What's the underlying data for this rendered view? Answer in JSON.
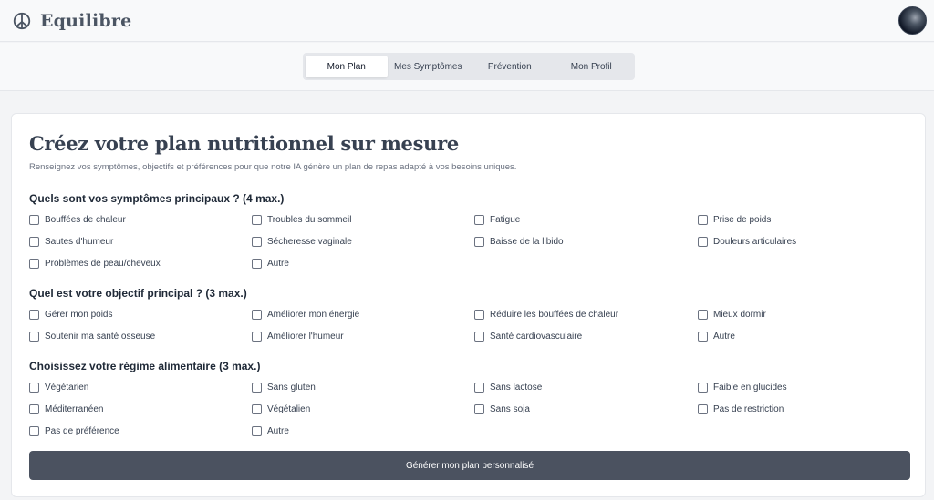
{
  "app": {
    "name": "Equilibre"
  },
  "tabs": [
    {
      "label": "Mon Plan",
      "active": true
    },
    {
      "label": "Mes Symptômes",
      "active": false
    },
    {
      "label": "Prévention",
      "active": false
    },
    {
      "label": "Mon Profil",
      "active": false
    }
  ],
  "plan": {
    "title": "Créez votre plan nutritionnel sur mesure",
    "subtitle": "Renseignez vos symptômes, objectifs et préférences pour que notre IA génère un plan de repas adapté à vos besoins uniques.",
    "sections": [
      {
        "title": "Quels sont vos symptômes principaux ? (4 max.)",
        "options": [
          "Bouffées de chaleur",
          "Troubles du sommeil",
          "Fatigue",
          "Prise de poids",
          "Sautes d'humeur",
          "Sécheresse vaginale",
          "Baisse de la libido",
          "Douleurs articulaires",
          "Problèmes de peau/cheveux",
          "Autre"
        ]
      },
      {
        "title": "Quel est votre objectif principal ? (3 max.)",
        "options": [
          "Gérer mon poids",
          "Améliorer mon énergie",
          "Réduire les bouffées de chaleur",
          "Mieux dormir",
          "Soutenir ma santé osseuse",
          "Améliorer l'humeur",
          "Santé cardiovasculaire",
          "Autre"
        ]
      },
      {
        "title": "Choisissez votre régime alimentaire (3 max.)",
        "options": [
          "Végétarien",
          "Sans gluten",
          "Sans lactose",
          "Faible en glucides",
          "Méditerranéen",
          "Végétalien",
          "Sans soja",
          "Pas de restriction",
          "Pas de préférence",
          "Autre"
        ]
      }
    ],
    "generate_label": "Générer mon plan personnalisé"
  },
  "colors": {
    "accent": "#4b5260",
    "background": "#f3f4f6",
    "card": "#ffffff"
  },
  "icons": {
    "logo": "peace-symbol-icon",
    "avatar": "user-avatar"
  }
}
